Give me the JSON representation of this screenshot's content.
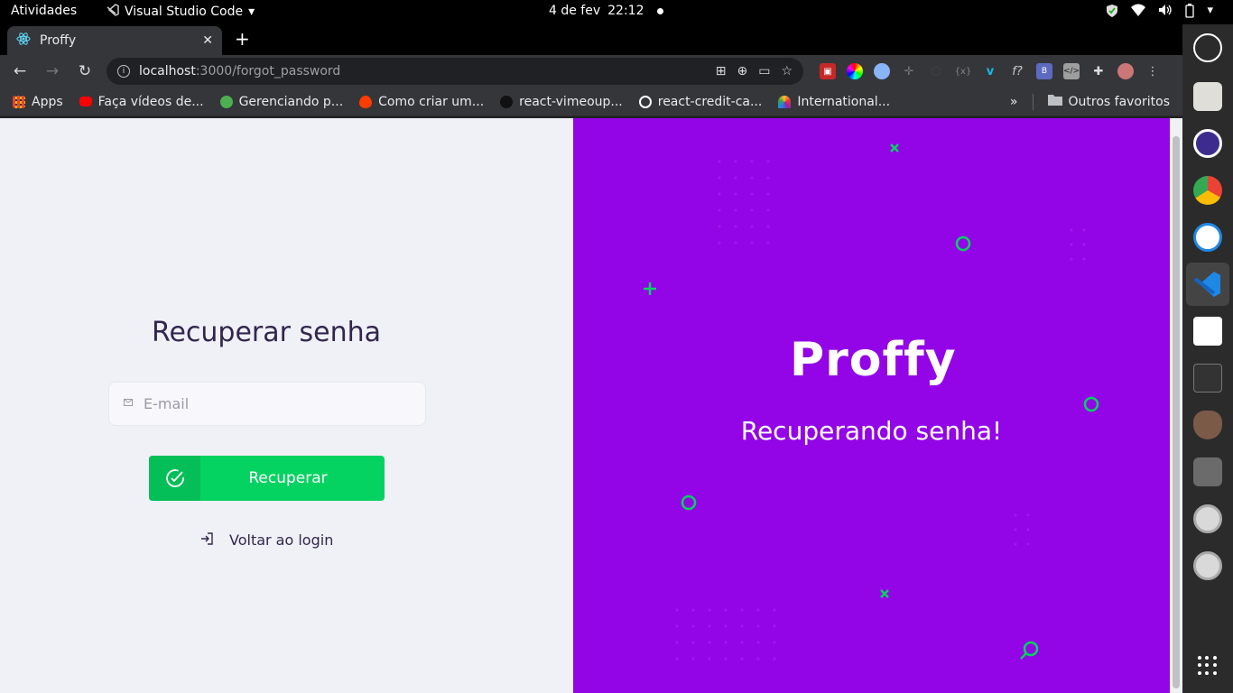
{
  "topbar": {
    "activities": "Atividades",
    "app_name": "Visual Studio Code",
    "date": "4 de fev",
    "time": "22:12"
  },
  "browser": {
    "tab_title": "Proffy",
    "url_host": "localhost",
    "url_path": ":3000/forgot_password",
    "bookmarks": [
      {
        "label": "Apps",
        "icon": "apps-grid-icon",
        "color": "#ea4335"
      },
      {
        "label": "Faça vídeos de...",
        "icon": "youtube-icon",
        "color": "#ff0000"
      },
      {
        "label": "Gerenciando p...",
        "icon": "bookmark-icon",
        "color": "#4caf50"
      },
      {
        "label": "Como criar um...",
        "icon": "flame-icon",
        "color": "#ff3d00"
      },
      {
        "label": "react-vimeoup...",
        "icon": "github-icon",
        "color": "#111111"
      },
      {
        "label": "react-credit-ca...",
        "icon": "globe-icon",
        "color": "#ffffff"
      },
      {
        "label": "International...",
        "icon": "nbc-icon",
        "color": "#8e24aa"
      }
    ],
    "more": "»",
    "other_bookmarks": "Outros favoritos"
  },
  "form": {
    "title": "Recuperar senha",
    "email_placeholder": "E-mail",
    "submit_label": "Recuperar",
    "back_label": "Voltar ao login"
  },
  "hero": {
    "brand": "Proffy",
    "tagline": "Recuperando senha!"
  },
  "colors": {
    "hero_bg": "#9305e6",
    "accent_green": "#04d361",
    "form_bg": "#f0f0f7",
    "decor": "#04d361"
  }
}
